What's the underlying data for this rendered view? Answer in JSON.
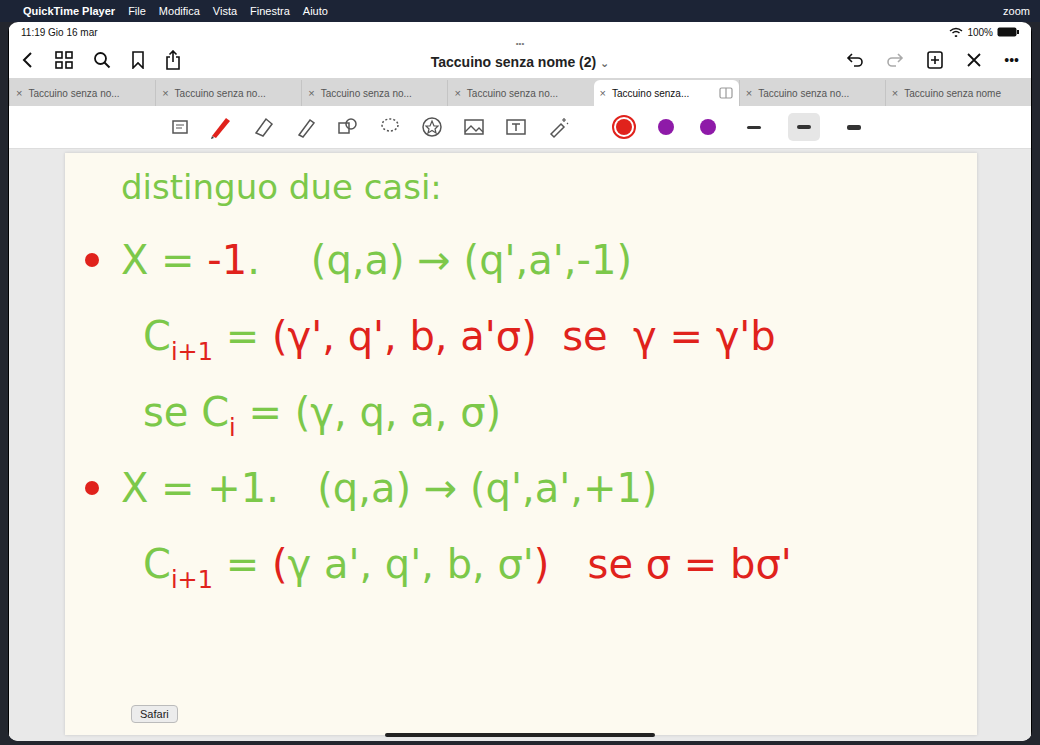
{
  "menubar": {
    "apple": "",
    "app": "QuickTime Player",
    "items": [
      "File",
      "Modifica",
      "Vista",
      "Finestra",
      "Aiuto"
    ],
    "zoom": "zoom"
  },
  "status_bar": {
    "time": "11:19  Gio 16 mar",
    "battery": "100%"
  },
  "nav": {
    "dots": "•••",
    "title": "Taccuino senza nome (2)",
    "chevron": "⌄",
    "more": "•••"
  },
  "tabs": [
    {
      "label": "Taccuino senza no...",
      "selected": false,
      "close": "×"
    },
    {
      "label": "Taccuino senza no...",
      "selected": false,
      "close": "×"
    },
    {
      "label": "Taccuino senza no...",
      "selected": false,
      "close": "×"
    },
    {
      "label": "Taccuino senza no...",
      "selected": false,
      "close": "×"
    },
    {
      "label": "Taccuino senza...",
      "selected": true,
      "close": "×"
    },
    {
      "label": "Taccuino senza no...",
      "selected": false,
      "close": "×"
    },
    {
      "label": "Taccuino senza nome",
      "selected": false,
      "close": "×"
    }
  ],
  "toolbar": {
    "colors": [
      {
        "color": "#e0221c",
        "selected": true
      },
      {
        "color": "#8e1aa8",
        "selected": false
      },
      {
        "color": "#8e1aa8",
        "selected": false
      }
    ],
    "widths": [
      {
        "selected": false
      },
      {
        "selected": true
      },
      {
        "selected": false
      }
    ]
  },
  "notes": [
    {
      "bullet": false,
      "segments": [
        {
          "text": "distinguo due casi:",
          "color": "#7cc84a",
          "sub": false
        }
      ]
    },
    {
      "bullet": true,
      "segments": [
        {
          "text": "X = ",
          "color": "#7cc84a",
          "sub": false
        },
        {
          "text": "-1",
          "color": "#e0221c",
          "sub": false
        },
        {
          "text": ".    (q,a) → (q',a',-1)",
          "color": "#7cc84a",
          "sub": false
        }
      ]
    },
    {
      "bullet": false,
      "segments": [
        {
          "text": "C",
          "color": "#7cc84a",
          "sub": false
        },
        {
          "text": "i+1",
          "color": "#e0221c",
          "sub": true
        },
        {
          "text": " = ",
          "color": "#7cc84a",
          "sub": false
        },
        {
          "text": "(γ', q', b, a'σ)",
          "color": "#e0221c",
          "sub": false
        },
        {
          "text": "  se  γ = γ'b",
          "color": "#e0221c",
          "sub": false
        }
      ]
    },
    {
      "bullet": false,
      "segments": [
        {
          "text": "se C",
          "color": "#7cc84a",
          "sub": false
        },
        {
          "text": "i",
          "color": "#e0221c",
          "sub": true
        },
        {
          "text": " = (γ, q, a, σ)",
          "color": "#7cc84a",
          "sub": false
        }
      ]
    },
    {
      "bullet": true,
      "segments": [
        {
          "text": "X = +1.   (q,a) → (q',a',+1)",
          "color": "#7cc84a",
          "sub": false
        }
      ]
    },
    {
      "bullet": false,
      "segments": [
        {
          "text": "C",
          "color": "#7cc84a",
          "sub": false
        },
        {
          "text": "i+1",
          "color": "#e0221c",
          "sub": true
        },
        {
          "text": " = ",
          "color": "#7cc84a",
          "sub": false
        },
        {
          "text": "(",
          "color": "#e0221c",
          "sub": false
        },
        {
          "text": "γ a', q', b, σ'",
          "color": "#7cc84a",
          "sub": false
        },
        {
          "text": ")",
          "color": "#e0221c",
          "sub": false
        },
        {
          "text": "   se σ = bσ'",
          "color": "#e0221c",
          "sub": false
        }
      ]
    }
  ],
  "tooltip": "Safari"
}
